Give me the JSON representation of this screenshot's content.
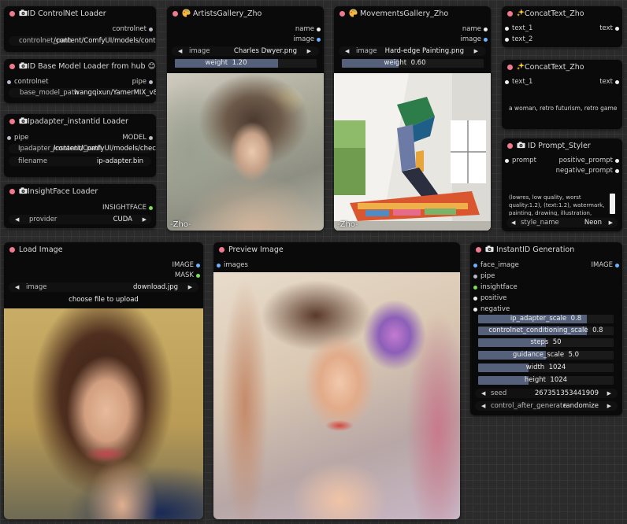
{
  "colors": {
    "node_bg": "#0a0a0a",
    "title_dot": "#f0798e",
    "socket_grey": "#b8b8c8",
    "socket_blue": "#6fb0ff",
    "socket_green": "#7edc5a",
    "slider_fill": "#55607a"
  },
  "nodes": {
    "controlnet_loader": {
      "title": "ID ControlNet Loader",
      "icon": "camera-icon",
      "output": "controlnet",
      "widget_label": "controlnet_path",
      "widget_value": "/content/ComfyUI/models/contro"
    },
    "base_model_loader": {
      "title": "ID Base Model Loader from hub",
      "icon": "camera-icon",
      "emoji": "😊",
      "input": "controlnet",
      "output": "pipe",
      "widget_label": "base_model_path",
      "widget_value": "wangqixun/YamerMIX_v8"
    },
    "ipadapter_loader": {
      "title": "Ipadapter_instantid Loader",
      "icon": "camera-icon",
      "input": "pipe",
      "output": "MODEL",
      "widget1_label": "Ipadapter_instantid_path",
      "widget1_value": "/content/ComfyUI/models/checkp",
      "widget2_label": "filename",
      "widget2_value": "ip-adapter.bin"
    },
    "insightface_loader": {
      "title": "InsightFace Loader",
      "icon": "camera-icon",
      "output": "INSIGHTFACE",
      "combo_label": "provider",
      "combo_value": "CUDA"
    },
    "artists_gallery": {
      "title": "ArtistsGallery_Zho",
      "icon": "palette-icon",
      "out1": "name",
      "out2": "image",
      "combo_label": "image",
      "combo_value": "Charles Dwyer.png",
      "slider_label": "weight",
      "slider_value": "1.20",
      "watermark": "-Zho-"
    },
    "movements_gallery": {
      "title": "MovementsGallery_Zho",
      "icon": "palette-icon",
      "out1": "name",
      "out2": "image",
      "combo_label": "image",
      "combo_value": "Hard-edge Painting.png",
      "slider_label": "weight",
      "slider_value": "0.60",
      "watermark": "-Zho-"
    },
    "concat_text_1": {
      "title": "ConcatText_Zho",
      "icon": "sparkles-icon",
      "in1": "text_1",
      "in2": "text_2",
      "output": "text"
    },
    "concat_text_2": {
      "title": "ConcatText_Zho",
      "icon": "sparkles-icon",
      "in1": "text_1",
      "output": "text",
      "text": "a woman, retro futurism, retro game"
    },
    "prompt_styler": {
      "title": "ID Prompt_Styler",
      "icon": "camera-icon",
      "input": "prompt",
      "out1": "positive_prompt",
      "out2": "negative_prompt",
      "text": "(lowres, low quality, worst quality:1.2), (text:1.2), watermark, painting, drawing, illustration, glitch, deformed",
      "combo_label": "style_name",
      "combo_value": "Neon"
    },
    "load_image": {
      "title": "Load Image",
      "out1": "IMAGE",
      "out2": "MASK",
      "combo_label": "image",
      "combo_value": "download.jpg",
      "upload_button": "choose file to upload"
    },
    "preview_image": {
      "title": "Preview Image",
      "input": "images"
    },
    "instantid_generation": {
      "title": "InstantID Generation",
      "icon": "camera-icon",
      "output": "IMAGE",
      "inputs": [
        "face_image",
        "pipe",
        "insightface",
        "positive",
        "negative"
      ],
      "sliders": [
        {
          "label": "ip_adapter_scale",
          "value": "0.8",
          "fraction": 0.8
        },
        {
          "label": "controlnet_conditioning_scale",
          "value": "0.8",
          "fraction": 0.8
        },
        {
          "label": "steps",
          "value": "50",
          "fraction": 0.5
        },
        {
          "label": "guidance_scale",
          "value": "5.0",
          "fraction": 0.5
        },
        {
          "label": "width",
          "value": "1024",
          "fraction": 0.37
        },
        {
          "label": "height",
          "value": "1024",
          "fraction": 0.37
        }
      ],
      "seed_label": "seed",
      "seed_value": "267351353441909",
      "control_label": "control_after_generate",
      "control_value": "randomize"
    }
  }
}
